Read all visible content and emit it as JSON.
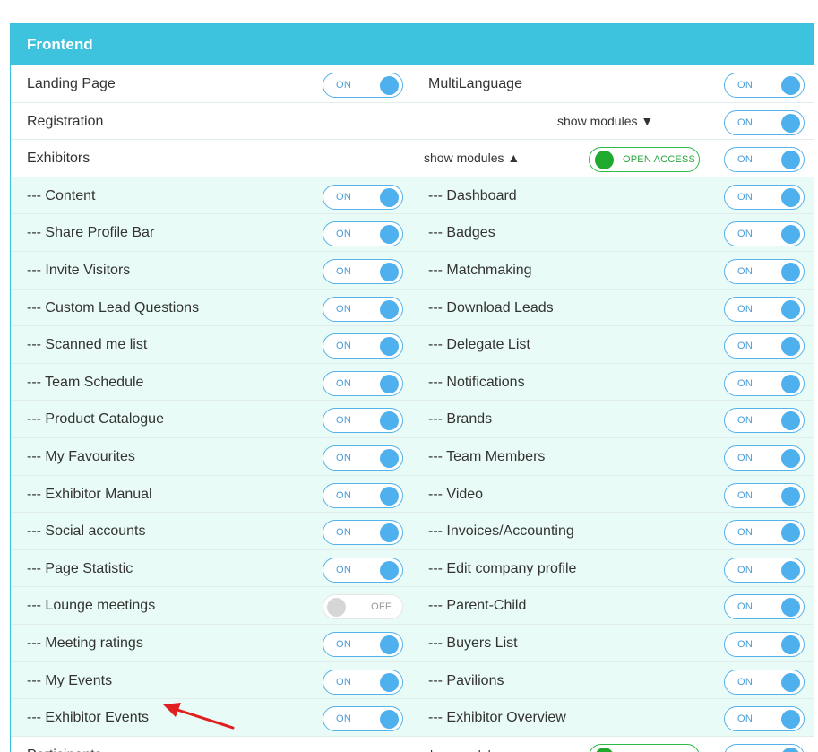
{
  "panel": {
    "title": "Frontend"
  },
  "toggle_states": {
    "on": "ON",
    "off": "OFF"
  },
  "top_rows": {
    "landing_page": "Landing Page",
    "multilanguage": "MultiLanguage",
    "registration": "Registration",
    "registration_modules": "show modules ▼",
    "exhibitors": "Exhibitors",
    "exhibitors_modules": "show modules ▲",
    "open_access": "OPEN ACCESS"
  },
  "module_rows": [
    {
      "left": "--- Content",
      "left_state": "ON",
      "right": "--- Dashboard",
      "right_state": "ON"
    },
    {
      "left": "--- Share Profile Bar",
      "left_state": "ON",
      "right": "--- Badges",
      "right_state": "ON"
    },
    {
      "left": "--- Invite Visitors",
      "left_state": "ON",
      "right": "--- Matchmaking",
      "right_state": "ON"
    },
    {
      "left": "--- Custom Lead Questions",
      "left_state": "ON",
      "right": "--- Download Leads",
      "right_state": "ON"
    },
    {
      "left": "--- Scanned me list",
      "left_state": "ON",
      "right": "--- Delegate List",
      "right_state": "ON"
    },
    {
      "left": "--- Team Schedule",
      "left_state": "ON",
      "right": "--- Notifications",
      "right_state": "ON"
    },
    {
      "left": "--- Product Catalogue",
      "left_state": "ON",
      "right": "--- Brands",
      "right_state": "ON"
    },
    {
      "left": "--- My Favourites",
      "left_state": "ON",
      "right": "--- Team Members",
      "right_state": "ON"
    },
    {
      "left": "--- Exhibitor Manual",
      "left_state": "ON",
      "right": "--- Video",
      "right_state": "ON"
    },
    {
      "left": "--- Social accounts",
      "left_state": "ON",
      "right": "--- Invoices/Accounting",
      "right_state": "ON"
    },
    {
      "left": "--- Page Statistic",
      "left_state": "ON",
      "right": "--- Edit company profile",
      "right_state": "ON"
    },
    {
      "left": "--- Lounge meetings",
      "left_state": "OFF",
      "right": "--- Parent-Child",
      "right_state": "ON"
    },
    {
      "left": "--- Meeting ratings",
      "left_state": "ON",
      "right": "--- Buyers List",
      "right_state": "ON"
    },
    {
      "left": "--- My Events",
      "left_state": "ON",
      "right": "--- Pavilions",
      "right_state": "ON"
    },
    {
      "left": "--- Exhibitor Events",
      "left_state": "ON",
      "right": "--- Exhibitor Overview",
      "right_state": "ON"
    }
  ],
  "partial_row": {
    "left": "Participants",
    "modules": "show modules ▼",
    "open_access": "OPEN ACCESS"
  },
  "colors": {
    "header_bg": "#3ec3df",
    "sub_row_bg": "#e9fbf6",
    "toggle_on": "#4fb0ee",
    "open_access": "#1faa2e",
    "annotation_arrow": "#e02020"
  },
  "annotation": {
    "icon": "red-arrow-icon",
    "points_to": "--- Exhibitor Events"
  }
}
